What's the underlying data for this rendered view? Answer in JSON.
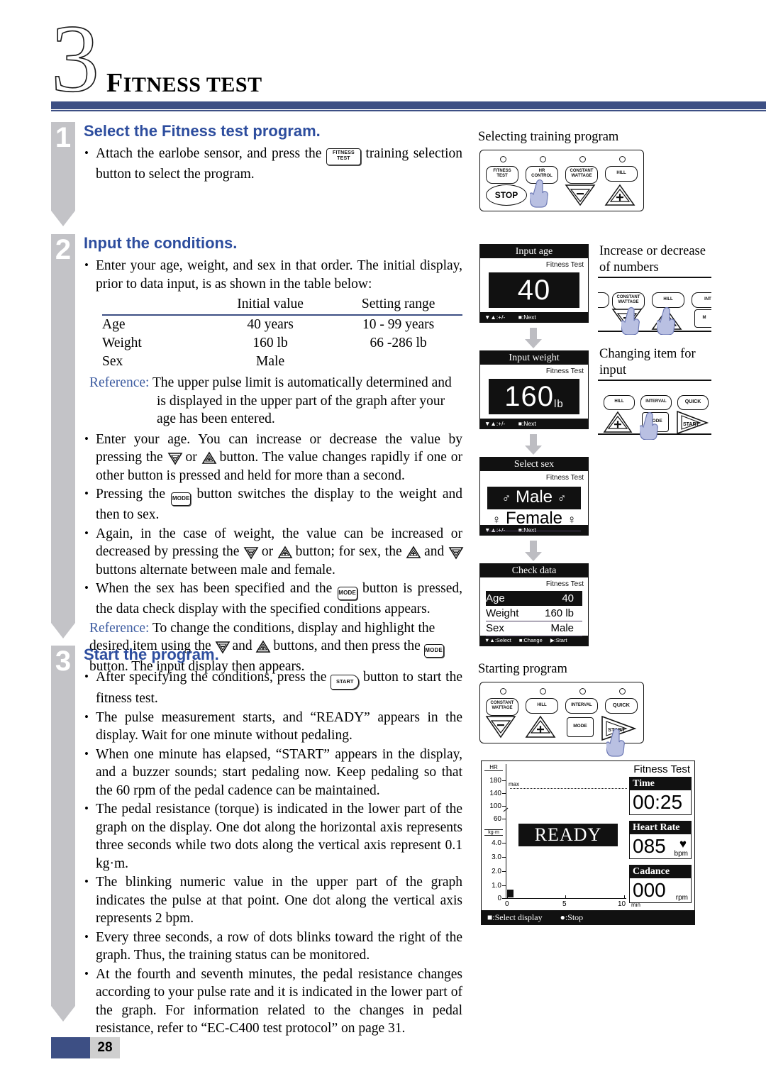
{
  "header": {
    "chapter_number": "3",
    "title_first": "F",
    "title_rest": "ITNESS TEST"
  },
  "steps": [
    {
      "number": "1",
      "heading": "Select the Fitness test program.",
      "bullets": [
        "Attach the earlobe sensor, and press the ¤ training selection button to select the program."
      ],
      "bullet_parts": {
        "b1a": "Attach the earlobe sensor, and press the",
        "b1b": "training selection button to select the program."
      }
    },
    {
      "number": "2",
      "heading": "Input the conditions.",
      "intro": "Enter your age, weight, and sex in that order. The initial display, prior to data input, is as shown in the table below:",
      "table": {
        "columns": [
          "",
          "Initial value",
          "Setting range"
        ],
        "rows": [
          [
            "Age",
            "40  years",
            "10 - 99  years"
          ],
          [
            "Weight",
            "160 lb",
            "66 -286 lb"
          ],
          [
            "Sex",
            "Male",
            ""
          ]
        ]
      },
      "reference1_label": "Reference:",
      "reference1_line1": "The upper pulse limit is automatically determined and",
      "reference1_line2": "is displayed in the upper part of the graph after your age has been entered.",
      "b_age_1": "Enter your age. You can increase or decrease the value by pressing the",
      "b_age_2": "or",
      "b_age_3": "button. The value changes rapidly if one or other button is pressed and held for more than a second.",
      "b_mode_1": "Pressing the",
      "b_mode_2": "button switches the display to the weight and then to sex.",
      "b_again_1": "Again, in the case of weight, the value can be increased or decreased by pressing the",
      "b_again_2": "or",
      "b_again_3": "button; for sex, the",
      "b_again_4": "and",
      "b_again_5": "buttons alternate between male and female.",
      "b_sexmode_1": "When the sex has been specified and the",
      "b_sexmode_2": "button is pressed, the data check display with the specified conditions appears.",
      "reference2_label": "Reference:",
      "reference2_a": "To change the conditions, display and highlight the desired item using the",
      "reference2_b": "and",
      "reference2_c": "buttons, and then press the",
      "reference2_d": "button. The input display then appears."
    },
    {
      "number": "3",
      "heading": "Start the program.",
      "b_start_1": "After specifying the conditions, press the",
      "b_start_2": "button to start the fitness test.",
      "bullets": [
        "The pulse measurement starts, and “READY” appears in the display. Wait for one minute without pedaling.",
        "When one minute has elapsed, “START” appears in the display, and a buzzer sounds; start pedaling now. Keep pedaling so that the 60 rpm of the pedal cadence can be maintained.",
        "The pedal resistance (torque) is indicated in the lower part of the graph on the display. One dot along the horizontal axis represents three seconds while two dots along the vertical axis represent 0.1 kg·m.",
        "The blinking numeric value in the upper part of the graph indicates the pulse at that point. One dot along the vertical axis represents 2 bpm.",
        "Every three seconds, a row of dots blinks toward the right of the graph. Thus, the training status can be monitored.",
        "At the fourth and seventh minutes, the pedal resistance changes according to your pulse rate and it is indicated in the lower part of the graph. For information related to the changes in pedal resistance, refer to “EC-C400 test protocol” on page 31."
      ]
    }
  ],
  "illustrations": {
    "panel1_caption": "Selecting training program",
    "panel1_buttons": [
      "FITNESS TEST",
      "HR CONTROL",
      "CONSTANT WATTAGE",
      "HILL"
    ],
    "panel1_stop": "STOP",
    "panel2_caption_line1": "Increase or decrease",
    "panel2_caption_line2": "of numbers",
    "panel2_buttons": [
      "CONSTANT WATTAGE",
      "HILL",
      "INT"
    ],
    "panel3_caption_line1": "Changing item for",
    "panel3_caption_line2": "input",
    "panel3_buttons": [
      "HILL",
      "INTERVAL",
      "QUICK"
    ],
    "panel3_keys": [
      "MODE",
      "START"
    ],
    "panel4_caption": "Starting program",
    "panel4_buttons": [
      "CONSTANT WATTAGE",
      "HILL",
      "INTERVAL",
      "QUICK"
    ],
    "panel4_keys": [
      "MODE",
      "START"
    ]
  },
  "lcds": {
    "age": {
      "title": "Input age",
      "program": "Fitness Test",
      "value": "40",
      "unit": "",
      "footer_left": "▼▲:+/-",
      "footer_right": "■:Next"
    },
    "weight": {
      "title": "Input weight",
      "program": "Fitness Test",
      "value": "160",
      "unit": "lb",
      "footer_left": "▼▲:+/-",
      "footer_right": "■:Next"
    },
    "sex": {
      "title": "Select sex",
      "program": "Fitness Test",
      "option_selected": "Male",
      "option_other": "Female",
      "footer_left": "▼▲:+/-",
      "footer_right": "■:Next"
    },
    "check": {
      "title": "Check data",
      "program": "Fitness Test",
      "rows": [
        {
          "key": "Age",
          "value": "40"
        },
        {
          "key": "Weight",
          "value": "160 lb"
        },
        {
          "key": "Sex",
          "value": "Male"
        }
      ],
      "footer_1": "▼▲:Select",
      "footer_2": "■:Change",
      "footer_3": "▶:Start"
    }
  },
  "chart_data": {
    "type": "line",
    "title": "Fitness Test",
    "status_banner": "READY",
    "hr_axis_label": "HR",
    "hr_ticks": [
      "180",
      "140",
      "100",
      "60"
    ],
    "hr_max_marker": "max",
    "torque_axis_label": "kg·m",
    "torque_ticks": [
      "4.0",
      "3.0",
      "2.0",
      "1.0",
      "0"
    ],
    "x_ticks": [
      "0",
      "5",
      "10"
    ],
    "x_unit": "min",
    "xlabel": "min",
    "ylabel": "HR / kg·m",
    "series": [
      {
        "name": "heart rate",
        "values": []
      },
      {
        "name": "pedal torque",
        "values": [
          0.3
        ]
      }
    ],
    "readouts": [
      {
        "label": "Time",
        "value": "00:25",
        "unit": ""
      },
      {
        "label": "Heart Rate",
        "value": "085",
        "unit": "bpm"
      },
      {
        "label": "Cadance",
        "value": "000",
        "unit": "rpm"
      }
    ],
    "footer_select": "■:Select display",
    "footer_stop": "●:Stop",
    "grid": false,
    "legend": "none"
  },
  "footer": {
    "page_number": "28"
  },
  "colors": {
    "accent_blue": "#3d4f84",
    "heading_blue": "#2d4d9e",
    "step_gray": "#c3c3c7",
    "hand_blue": "#b9c0e2"
  }
}
